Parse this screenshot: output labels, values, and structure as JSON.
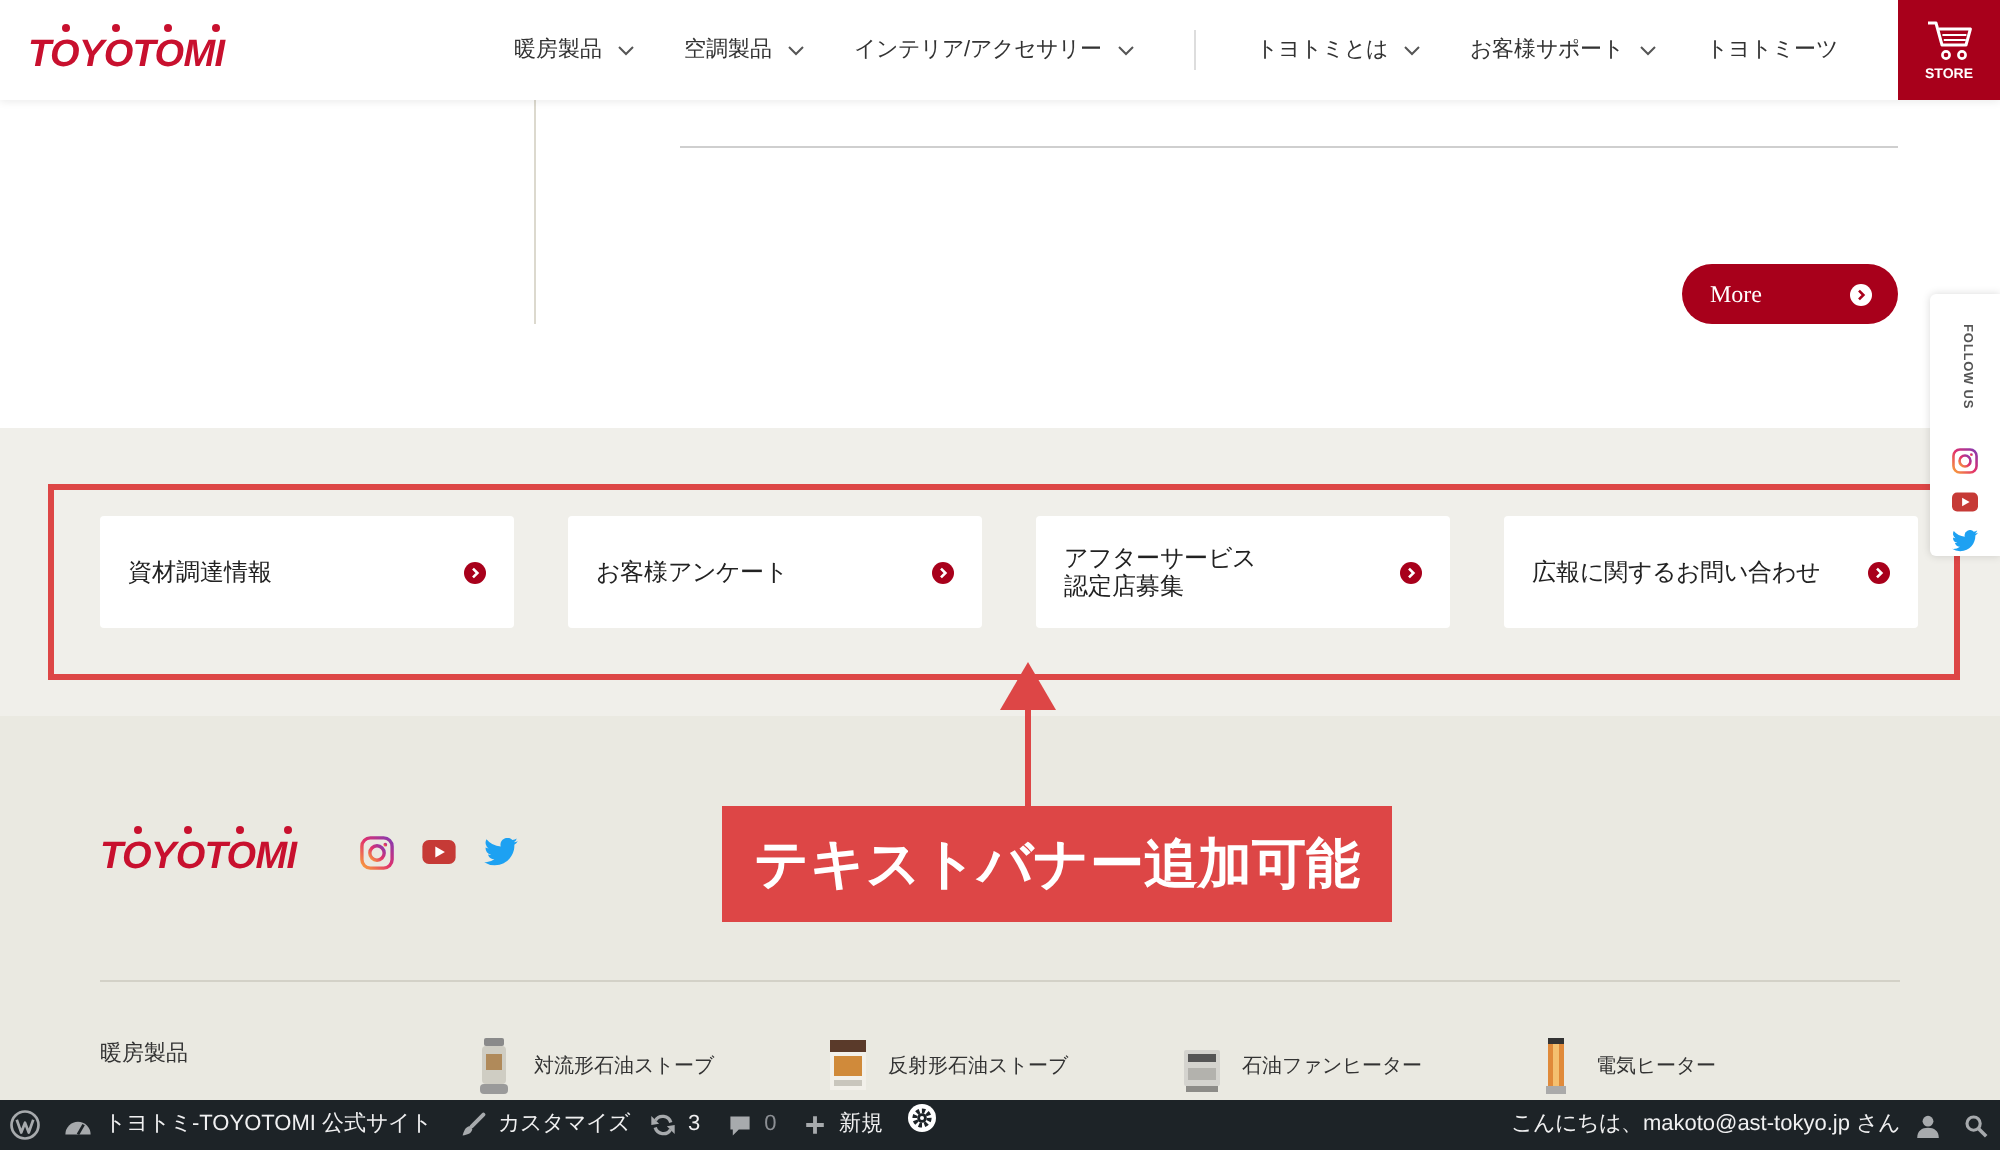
{
  "header": {
    "logo": "TOYOTOMI",
    "nav_groups": [
      {
        "items": [
          {
            "label": "暖房製品",
            "dropdown": true
          },
          {
            "label": "空調製品",
            "dropdown": true
          },
          {
            "label": "インテリア/アクセサリー",
            "dropdown": true
          }
        ]
      },
      {
        "items": [
          {
            "label": "トヨトミとは",
            "dropdown": true
          },
          {
            "label": "お客様サポート",
            "dropdown": true
          },
          {
            "label": "トヨトミーツ",
            "dropdown": false
          }
        ]
      }
    ],
    "store_button": "STORE"
  },
  "content": {
    "more_button": "More"
  },
  "follow_us": {
    "label": "FOLLOW US"
  },
  "text_banners": [
    {
      "lines": [
        "資材調達情報"
      ]
    },
    {
      "lines": [
        "お客様アンケート"
      ]
    },
    {
      "lines": [
        "アフターサービス",
        "認定店募集"
      ]
    },
    {
      "lines": [
        "広報に関するお問い合わせ"
      ]
    }
  ],
  "annotation": {
    "label": "テキストバナー追加可能"
  },
  "footer": {
    "logo": "TOYOTOMI",
    "category": "暖房製品",
    "products": [
      {
        "name": "対流形石油ストーブ"
      },
      {
        "name": "反射形石油ストーブ"
      },
      {
        "name": "石油ファンヒーター"
      },
      {
        "name": "電気ヒーター"
      }
    ]
  },
  "admin_bar": {
    "site_name": "トヨトミ-TOYOTOMI 公式サイト",
    "customize": "カスタマイズ",
    "updates": "3",
    "comments": "0",
    "new": "新規",
    "greeting": "こんにちは、makoto@ast-tokyo.jp さん"
  }
}
